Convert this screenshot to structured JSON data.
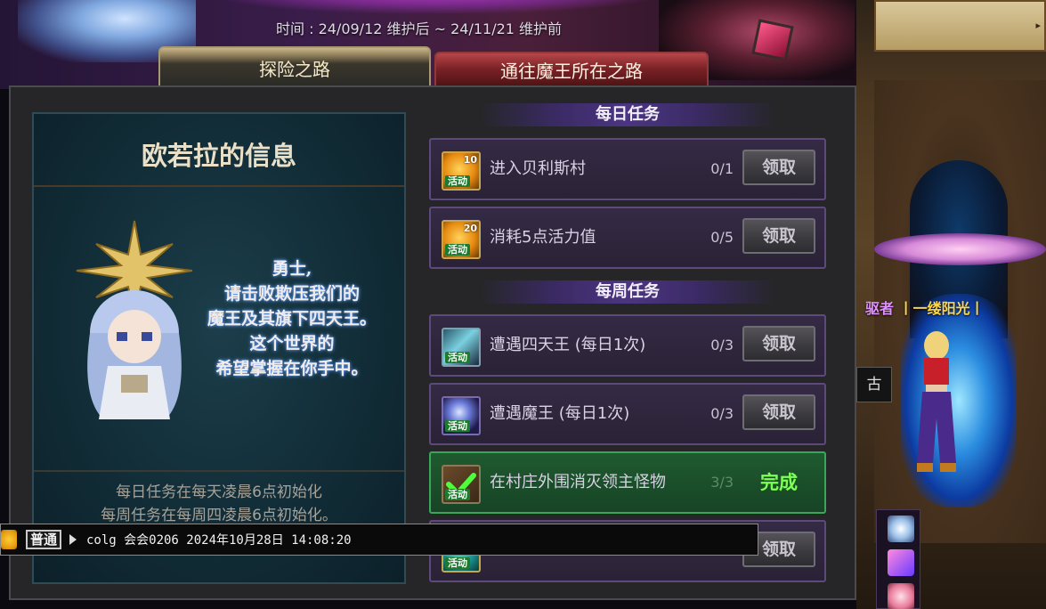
{
  "event": {
    "date_range": "时间 : 24/09/12 维护后 ~ 24/11/21 维护前"
  },
  "tabs": [
    {
      "label": "探险之路",
      "active": true
    },
    {
      "label": "通往魔王所在之路",
      "active": false
    }
  ],
  "info_panel": {
    "title": "欧若拉的信息",
    "message_lines": [
      "勇士,",
      "请击败欺压我们的",
      "魔王及其旗下四天王。",
      "这个世界的",
      "希望掌握在你手中。"
    ],
    "note_lines": [
      "每日任务在每天凌晨6点初始化",
      "每周任务在每周四凌晨6点初始化。"
    ]
  },
  "daily": {
    "header": "每日任务",
    "quests": [
      {
        "name": "进入贝利斯村",
        "progress": "0/1",
        "button": "领取",
        "icon": "vitality-coin-icon",
        "icon_num": "10",
        "icon_tag": "活动"
      },
      {
        "name": "消耗5点活力值",
        "progress": "0/5",
        "button": "领取",
        "icon": "vitality-coin-icon",
        "icon_num": "20",
        "icon_tag": "活动"
      }
    ]
  },
  "weekly": {
    "header": "每周任务",
    "quests": [
      {
        "name": "遭遇四天王 (每日1次)",
        "progress": "0/3",
        "button": "领取",
        "icon": "sword-icon",
        "icon_tag": "活动"
      },
      {
        "name": "遭遇魔王 (每日1次)",
        "progress": "0/3",
        "button": "领取",
        "icon": "orb-icon",
        "icon_tag": "活动"
      },
      {
        "name": "在村庄外围消灭领主怪物",
        "progress": "3/3",
        "status": "完成",
        "icon": "checkmark-icon",
        "icon_tag": "活动"
      },
      {
        "button": "领取",
        "icon": "vitality-coin-icon",
        "icon_tag": "活动"
      }
    ]
  },
  "scene": {
    "player_title_prefix": "驱者",
    "player_name": "丨一缕阳光丨",
    "tooltip_char": "古"
  },
  "chat": {
    "channel": "普通",
    "message": "colg 会会0206 2024年10月28日 14:08:20"
  },
  "colors": {
    "accent_purple": "#4b3582",
    "complete_green": "#7dff59",
    "tab_active": "#c9b58a",
    "tab_inactive": "#7a2226"
  }
}
